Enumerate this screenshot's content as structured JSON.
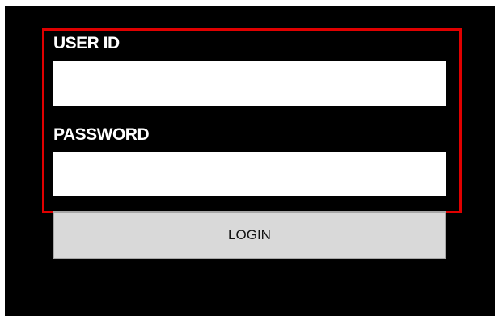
{
  "login_form": {
    "user_id_label": "USER ID",
    "user_id_value": "",
    "password_label": "PASSWORD",
    "password_value": "",
    "login_button_label": "LOGIN"
  },
  "colors": {
    "background": "#000000",
    "highlight_border": "#e00000",
    "input_background": "#ffffff",
    "button_background": "#d9d9d9",
    "button_border": "#a6a6a6"
  }
}
